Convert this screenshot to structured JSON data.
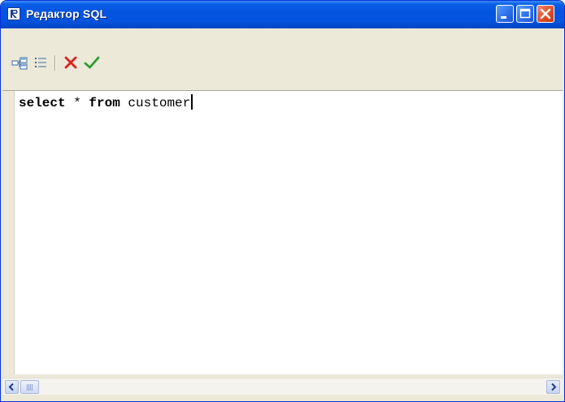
{
  "window": {
    "title": "Редактор SQL",
    "app_icon": "fastreport-logo-icon",
    "controls": [
      "minimize-icon",
      "maximize-icon",
      "close-icon"
    ]
  },
  "toolbar": {
    "buttons": [
      {
        "icon": "query-builder-icon"
      },
      {
        "icon": "list-icon"
      },
      {
        "icon": "cancel-icon",
        "color": "#e02020"
      },
      {
        "icon": "check-icon",
        "color": "#2f9a2f"
      }
    ]
  },
  "editor": {
    "tokens": [
      {
        "text": "select",
        "bold": true
      },
      {
        "text": " * ",
        "bold": false
      },
      {
        "text": "from",
        "bold": true
      },
      {
        "text": " customer",
        "bold": false
      }
    ]
  },
  "scrollbar": {
    "left_icon": "arrow-left-icon",
    "right_icon": "arrow-right-icon"
  },
  "colors": {
    "titlebar": "#0554e0",
    "close_button": "#dc4b23",
    "window_bg": "#ece9d8"
  }
}
